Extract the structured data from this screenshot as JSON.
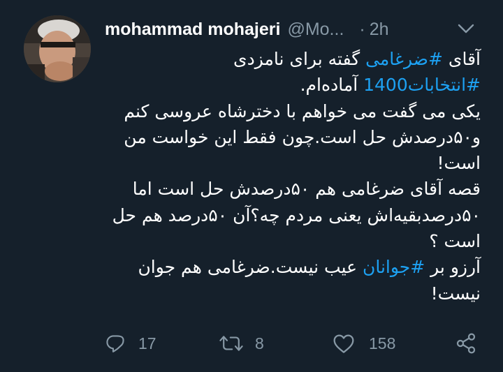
{
  "tweet": {
    "author_name": "mohammad mohajeri",
    "author_handle": "@Mo...",
    "separator": "·",
    "time": "2h",
    "paragraphs": [
      {
        "segments": [
          {
            "text": "آقای ",
            "tag": false
          },
          {
            "text": "#ضرغامی",
            "tag": true
          },
          {
            "text": " گفته برای نامزدی",
            "tag": false
          },
          {
            "text": "\n",
            "tag": false
          },
          {
            "text": "#انتخابات1400",
            "tag": true
          },
          {
            "text": " آماده‌ام.",
            "tag": false
          }
        ]
      },
      {
        "segments": [
          {
            "text": "یکی می گفت می خواهم با دخترشاه عروسی کنم و۵۰درصدش حل است.چون فقط این خواست من است!",
            "tag": false
          }
        ]
      },
      {
        "segments": [
          {
            "text": "قصه آقای ضرغامی هم ۵۰درصدش حل است اما ۵۰درصدبقیه‌اش یعنی مردم چه؟آن ۵۰درصد هم حل است ؟",
            "tag": false
          }
        ]
      },
      {
        "segments": [
          {
            "text": "آرزو بر ",
            "tag": false
          },
          {
            "text": "#جوانان",
            "tag": true
          },
          {
            "text": " عیب نیست.ضرغامی هم جوان نیست!",
            "tag": false
          }
        ]
      }
    ]
  },
  "actions": {
    "reply_count": "17",
    "retweet_count": "8",
    "like_count": "158"
  },
  "colors": {
    "background": "#15202b",
    "text": "#ffffff",
    "secondary": "#8899a6",
    "accent": "#1da1f2"
  },
  "icons": {
    "more": "chevron-down-icon",
    "reply": "reply-icon",
    "retweet": "retweet-icon",
    "like": "heart-icon",
    "share": "share-icon"
  }
}
